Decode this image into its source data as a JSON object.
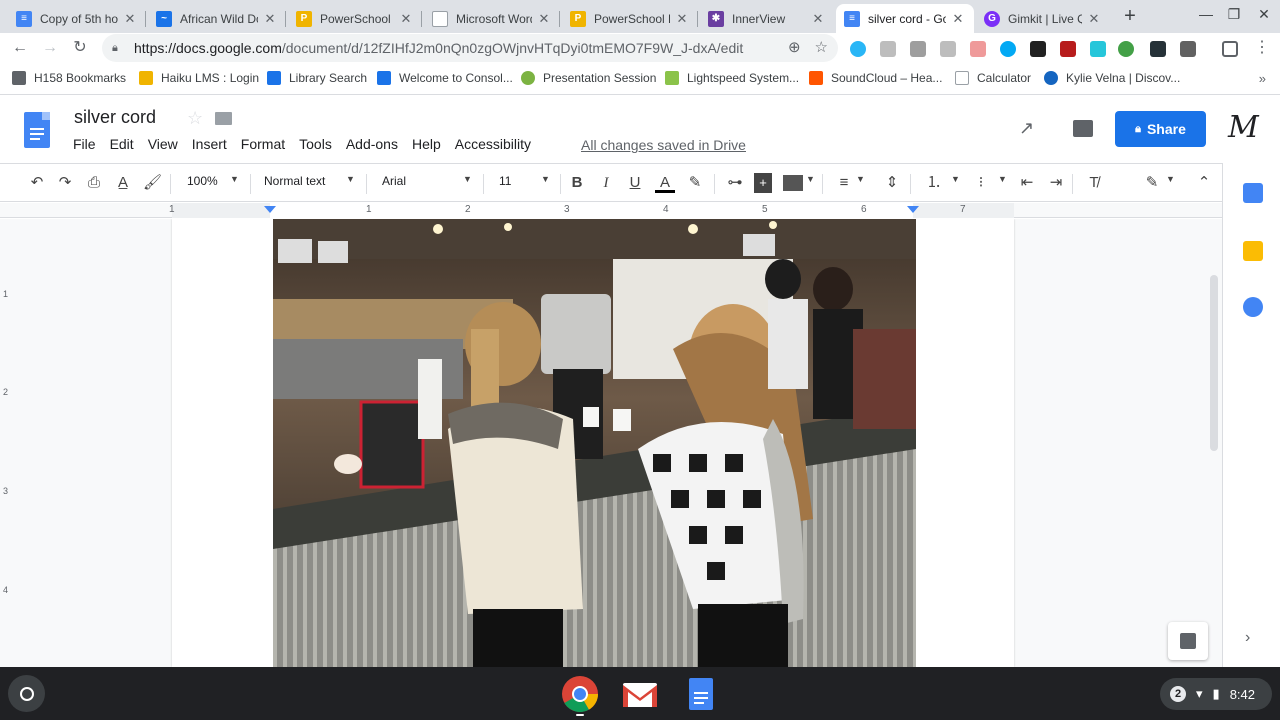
{
  "browser": {
    "tabs": [
      {
        "title": "Copy of 5th ho",
        "fav_color": "#4285f4",
        "fav_glyph": "≡"
      },
      {
        "title": "African Wild Do",
        "fav_color": "#1a73e8",
        "fav_glyph": "~"
      },
      {
        "title": "PowerSchool Lo",
        "fav_color": "#f0b400",
        "fav_glyph": "P"
      },
      {
        "title": "Microsoft Word",
        "fav_color": "#9aa0a6",
        "fav_glyph": ""
      },
      {
        "title": "PowerSchool Lo",
        "fav_color": "#f0b400",
        "fav_glyph": "P"
      },
      {
        "title": "InnerView",
        "fav_color": "#6a3ea1",
        "fav_glyph": "✱"
      },
      {
        "title": "silver cord - Goo",
        "fav_color": "#4285f4",
        "fav_glyph": "≡"
      },
      {
        "title": "Gimkit | Live Qu",
        "fav_color": "#7b2ff7",
        "fav_glyph": "G"
      }
    ],
    "url_host": "https://docs.google.com",
    "url_path": "/document/d/12fZIHfJ2m0nQn0zgOWjnvHTqDyi0tmEMO7F9W_J-dxA/edit",
    "bookmarks": [
      {
        "label": "H158 Bookmarks",
        "color": "#5f6368"
      },
      {
        "label": "Haiku LMS : Login",
        "color": "#f0b400"
      },
      {
        "label": "Library Search",
        "color": "#1a73e8"
      },
      {
        "label": "Welcome to Consol...",
        "color": "#1a73e8"
      },
      {
        "label": "Presentation Session",
        "color": "#7cb342"
      },
      {
        "label": "Lightspeed System...",
        "color": "#8bc34a"
      },
      {
        "label": "SoundCloud – Hea...",
        "color": "#ff5500"
      },
      {
        "label": "Calculator",
        "color": "#9aa0a6"
      },
      {
        "label": "Kylie Velna | Discov...",
        "color": "#1565c0"
      }
    ],
    "bookmarks_more": "»"
  },
  "docs": {
    "title": "silver cord",
    "menu": [
      "File",
      "Edit",
      "View",
      "Insert",
      "Format",
      "Tools",
      "Add-ons",
      "Help",
      "Accessibility"
    ],
    "saved_status": "All changes saved in Drive",
    "share_label": "Share",
    "avatar_letter": "M",
    "toolbar": {
      "zoom": "100%",
      "style": "Normal text",
      "font": "Arial",
      "size": "11"
    },
    "ruler_numbers": [
      "1",
      "1",
      "2",
      "3",
      "4",
      "5",
      "6",
      "7"
    ],
    "vruler_numbers": [
      "1",
      "2",
      "3",
      "4"
    ]
  },
  "colors": {
    "accent": "#1a73e8",
    "docs_blue": "#4285f4"
  },
  "shelf": {
    "time": "8:42",
    "notification_count": "2"
  }
}
